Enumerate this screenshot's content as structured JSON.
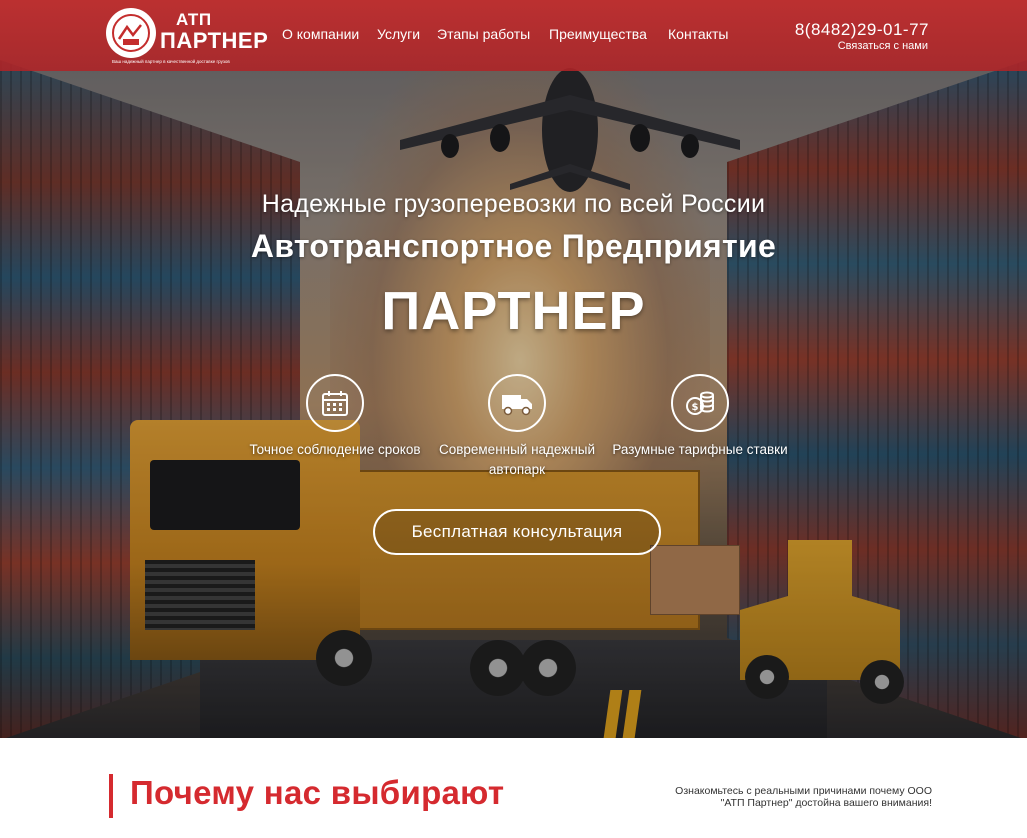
{
  "header": {
    "logo": {
      "title_line1": "АТП",
      "title_line2": "ПАРТНЕР",
      "tagline": "Ваш надежный партнер в качественной доставке грузов"
    },
    "nav": [
      {
        "label": "О компании"
      },
      {
        "label": "Услуги"
      },
      {
        "label": "Этапы работы"
      },
      {
        "label": "Преимущества"
      },
      {
        "label": "Контакты"
      }
    ],
    "phone": "8(8482)29-01-77",
    "callback": "Связаться с нами"
  },
  "hero": {
    "subtitle": "Надежные грузоперевозки по всей России",
    "title": "Автотранспортное Предприятие",
    "brand": "ПАРТНЕР",
    "features": [
      {
        "icon": "calendar-icon",
        "text": "Точное соблюдение сроков"
      },
      {
        "icon": "truck-icon",
        "text": "Современный надежный автопарк"
      },
      {
        "icon": "coins-icon",
        "text": "Разумные тарифные ставки"
      }
    ],
    "cta_label": "Бесплатная консультация"
  },
  "why": {
    "title": "Почему нас выбирают",
    "description": "Ознакомьтесь с реальными причинами почему ООО \"АТП Партнер\" достойна вашего внимания!"
  },
  "colors": {
    "header_bg": "#c42d2d",
    "accent_red": "#d52a2f",
    "white": "#ffffff"
  }
}
